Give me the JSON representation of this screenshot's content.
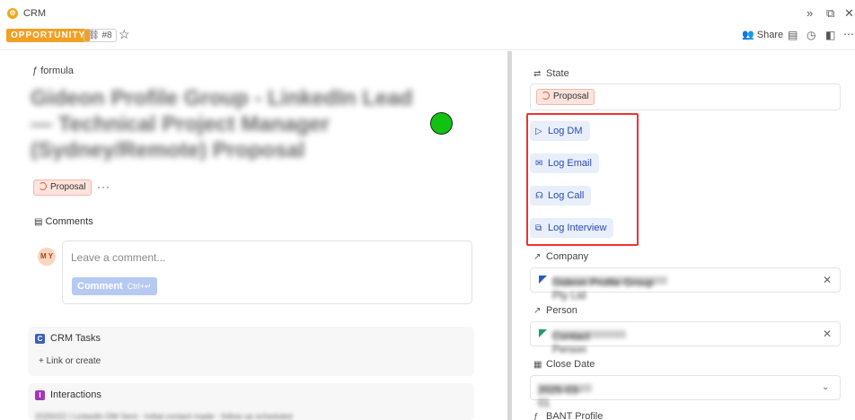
{
  "app": {
    "name": "CRM"
  },
  "record": {
    "type_badge": "OPPORTUNITY",
    "link_count": "8",
    "formula_label": "formula",
    "title": "Gideon Profile Group - LinkedIn Lead — Technical Project Manager (Sydney/Remote) Proposal",
    "state": "Proposal"
  },
  "toolbar": {
    "share_label": "Share"
  },
  "comments": {
    "heading": "Comments",
    "avatar_initials": "M Y",
    "placeholder": "Leave a comment...",
    "button_label": "Comment",
    "button_shortcut": "Ctrl+↵"
  },
  "tasks": {
    "letter": "C",
    "title": "CRM Tasks",
    "link_label": "Link or create"
  },
  "interactions": {
    "letter": "I",
    "title": "Interactions",
    "preview": "2025022 | LinkedIn DM Sent - Initial contact made - follow up scheduled"
  },
  "panel": {
    "state_label": "State",
    "state_value": "Proposal",
    "actions": [
      {
        "label": "Log DM",
        "icon": "send-icon"
      },
      {
        "label": "Log Email",
        "icon": "mail-icon"
      },
      {
        "label": "Log Call",
        "icon": "headset-icon"
      },
      {
        "label": "Log Interview",
        "icon": "chat-icon"
      }
    ],
    "company_label": "Company",
    "company_value": "Gideon Profile Group Pty Ltd",
    "person_label": "Person",
    "person_value": "Contact Person",
    "close_date_label": "Close Date",
    "close_date_value": "2025-03-01",
    "bant_label": "BANT Profile"
  },
  "colors": {
    "accent": "#2a4bb2",
    "opportunity_badge": "#f2a023",
    "state_chip_bg": "#fde3dd",
    "green_indicator": "#12c212",
    "highlight_box": "#ee3333"
  }
}
